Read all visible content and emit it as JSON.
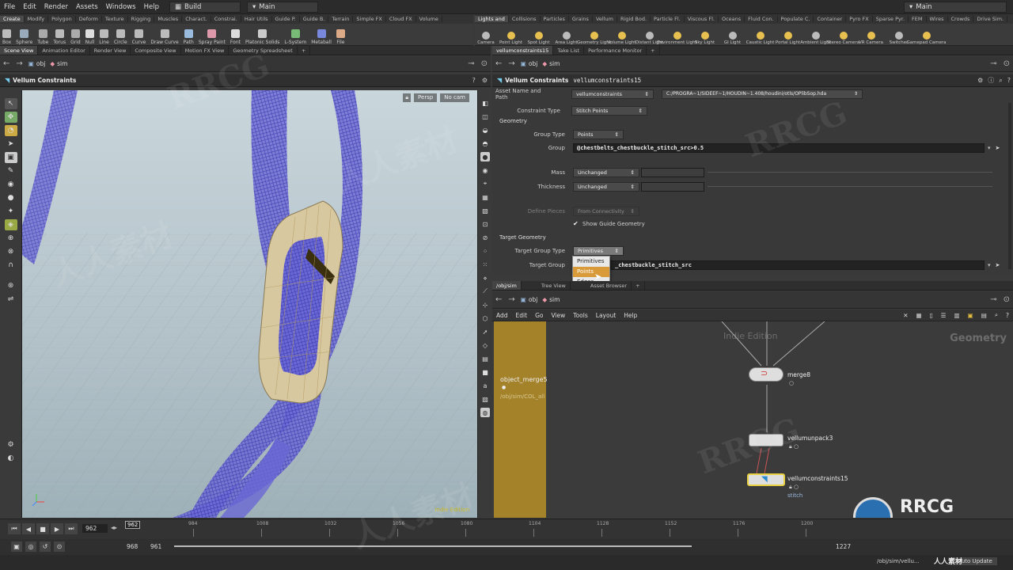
{
  "menubar": {
    "items": [
      "File",
      "Edit",
      "Render",
      "Assets",
      "Windows",
      "Help"
    ],
    "desktop_build": "Build",
    "desktop_main": "Main",
    "desktop_right": "Main"
  },
  "shelf_tabs_left": [
    "Create",
    "Modify",
    "Polygon",
    "Deform",
    "Texture",
    "Rigging",
    "Muscles",
    "Charact.",
    "Constrai.",
    "Hair Utils",
    "Guide P.",
    "Guide B.",
    "Terrain",
    "Simple FX",
    "Cloud FX",
    "Volume"
  ],
  "shelf_tabs_right": [
    "Lights and",
    "Collisions",
    "Particles",
    "Grains",
    "Vellum",
    "Rigid Bod.",
    "Particle Fl.",
    "Viscous Fl.",
    "Oceans",
    "Fluid Con.",
    "Populate C.",
    "Container",
    "Pyro FX",
    "Sparse Pyr.",
    "FEM",
    "Wires",
    "Crowds",
    "Drive Sim."
  ],
  "shelf_tools_left": [
    {
      "label": "Box",
      "icon": "box-icon"
    },
    {
      "label": "Sphere",
      "icon": "sphere-icon"
    },
    {
      "label": "Tube",
      "icon": "tube-icon"
    },
    {
      "label": "Torus",
      "icon": "torus-icon"
    },
    {
      "label": "Grid",
      "icon": "grid-icon"
    },
    {
      "label": "Null",
      "icon": "null-icon"
    },
    {
      "label": "Line",
      "icon": "line-icon"
    },
    {
      "label": "Circle",
      "icon": "circle-icon"
    },
    {
      "label": "Curve",
      "icon": "curve-icon"
    },
    {
      "label": "Draw Curve",
      "icon": "draw-curve-icon"
    },
    {
      "label": "Path",
      "icon": "path-icon"
    },
    {
      "label": "Spray Paint",
      "icon": "spray-paint-icon"
    },
    {
      "label": "Font",
      "icon": "font-icon"
    },
    {
      "label": "Platonic Solids",
      "icon": "platonic-icon"
    },
    {
      "label": "L-System",
      "icon": "lsystem-icon"
    },
    {
      "label": "Metaball",
      "icon": "metaball-icon"
    },
    {
      "label": "File",
      "icon": "file-icon"
    }
  ],
  "shelf_tools_right": [
    {
      "label": "Camera"
    },
    {
      "label": "Point Light"
    },
    {
      "label": "Spot Light"
    },
    {
      "label": "Area Light"
    },
    {
      "label": "Geometry Light"
    },
    {
      "label": "Volume Light"
    },
    {
      "label": "Distant Light"
    },
    {
      "label": "Environment Light"
    },
    {
      "label": "Sky Light"
    },
    {
      "label": "GI Light"
    },
    {
      "label": "Caustic Light"
    },
    {
      "label": "Portal Light"
    },
    {
      "label": "Ambient Light"
    },
    {
      "label": "Stereo Camera"
    },
    {
      "label": "VR Camera"
    },
    {
      "label": "Switcher"
    },
    {
      "label": "Gamepad Camera"
    }
  ],
  "left_pane_tabs": [
    "Scene View",
    "Animation Editor",
    "Render View",
    "Composite View",
    "Motion FX View",
    "Geometry Spreadsheet"
  ],
  "right_pane_tabs": [
    "vellumconstraints15",
    "Take List",
    "Performance Monitor"
  ],
  "left_path": {
    "obj": "obj",
    "sim": "sim"
  },
  "right_path": {
    "obj": "obj",
    "sim": "sim"
  },
  "viewport": {
    "title": "Vellum Constraints",
    "persp": "Persp",
    "cam": "No cam",
    "corner_label": "Indie Edition"
  },
  "params": {
    "node_type": "Vellum Constraints",
    "node_name": "vellumconstraints15",
    "asset_label": "Asset Name and Path",
    "asset_name": "vellumconstraints",
    "asset_path": "C:/PROGRA~1/SIDEEF~1/HOUDIN~1.408/houdini/otls/OPlibSop.hda",
    "constraint_type_label": "Constraint Type",
    "constraint_type": "Stitch Points",
    "geometry_section": "Geometry",
    "group_type_label": "Group Type",
    "group_type": "Points",
    "group_label": "Group",
    "group_value": "@chestbelts_chestbuckle_stitch_src>0.5",
    "mass_label": "Mass",
    "mass_value": "Unchanged",
    "thickness_label": "Thickness",
    "thickness_value": "Unchanged",
    "define_pieces_label": "Define Pieces",
    "define_pieces_value": "From Connectivity",
    "show_guide_label": "Show Guide Geometry",
    "target_section": "Target Geometry",
    "target_group_type_label": "Target Group Type",
    "target_group_type": "Primitives",
    "target_group_label": "Target Group",
    "target_group_value": "_chestbuckle_stitch_src"
  },
  "popup_options": [
    "Primitives",
    "Points",
    "Edges"
  ],
  "network_tabs": [
    "/obj/sim",
    "Tree View",
    "Asset Browser"
  ],
  "network_path": {
    "obj": "obj",
    "sim": "sim"
  },
  "network_menu": [
    "Add",
    "Edit",
    "Go",
    "View",
    "Tools",
    "Layout",
    "Help"
  ],
  "network": {
    "watermark_left": "Indie Edition",
    "context": "Geometry",
    "nodes": {
      "object_merge": "object_merge5",
      "object_merge_path": "/obj/sim/COL_all",
      "merge": "merge8",
      "unpack": "vellumunpack3",
      "constraints": "vellumconstraints15",
      "constraints_sub": "stitch"
    }
  },
  "timeline": {
    "current_frame": "962",
    "frame_box": "962",
    "ticks": [
      "984",
      "1008",
      "1032",
      "1056",
      "1080",
      "1104",
      "1128",
      "1152",
      "1176",
      "1200"
    ],
    "start": "968",
    "start2": "961",
    "end": "1227"
  },
  "status": {
    "path": "/obj/sim/vellu...",
    "update": "Auto Update"
  },
  "watermarks": [
    "RRCG",
    "人人素材"
  ],
  "logo": {
    "text1": "RRCG",
    "text2": "人人素材"
  }
}
